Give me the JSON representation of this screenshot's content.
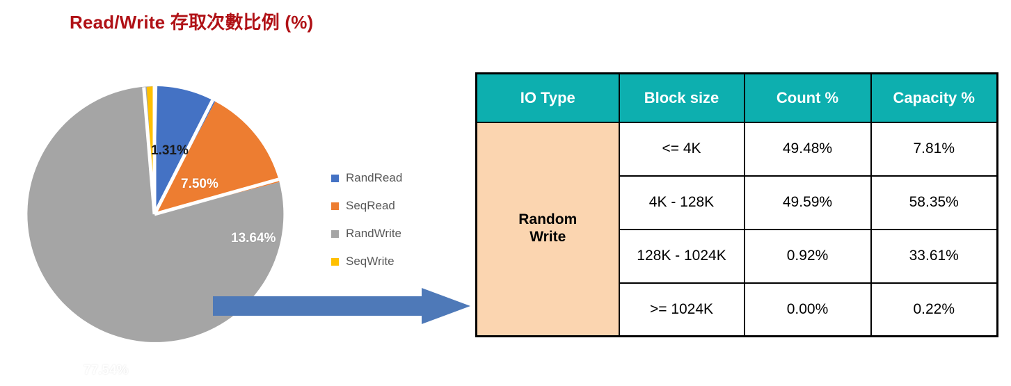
{
  "chart_data": {
    "type": "pie",
    "title": "Read/Write 存取次數比例 (%)",
    "unit": "%",
    "categories": [
      "RandRead",
      "SeqRead",
      "RandWrite",
      "SeqWrite"
    ],
    "values": [
      7.5,
      13.64,
      77.54,
      1.31
    ],
    "labels": [
      "7.50%",
      "13.64%",
      "77.54%",
      "1.31%"
    ],
    "colors": [
      "#4472C4",
      "#ED7D31",
      "#A5A5A5",
      "#FFC000"
    ],
    "legend_position": "right",
    "grid": false,
    "start_angle_deg": 0,
    "direction": "clockwise",
    "slice_gap": true
  },
  "title": {
    "text": "Read/Write 存取次數比例 (%)",
    "color": "#B01116"
  },
  "legend": {
    "items": [
      {
        "label": "RandRead",
        "color": "#4472C4"
      },
      {
        "label": "SeqRead",
        "color": "#ED7D31"
      },
      {
        "label": "RandWrite",
        "color": "#A5A5A5"
      },
      {
        "label": "SeqWrite",
        "color": "#FFC000"
      }
    ]
  },
  "pie_labels": {
    "seqwrite": "1.31%",
    "randread": "7.50%",
    "seqread": "13.64%",
    "randwrite": "77.54%"
  },
  "arrow": {
    "direction": "right",
    "color": "#4E79B8"
  },
  "table": {
    "accent_header_color": "#0DAFAF",
    "iotype_cell_color": "#FBD5B0",
    "headers": [
      "IO Type",
      "Block size",
      "Count %",
      "Capacity %"
    ],
    "io_type": "Random\nWrite",
    "io_type_line1": "Random",
    "io_type_line2": "Write",
    "rows": [
      {
        "block_size": "<= 4K",
        "count_pct": "49.48%",
        "capacity_pct": "7.81%"
      },
      {
        "block_size": "4K - 128K",
        "count_pct": "49.59%",
        "capacity_pct": "58.35%"
      },
      {
        "block_size": "128K - 1024K",
        "count_pct": "0.92%",
        "capacity_pct": "33.61%"
      },
      {
        "block_size": ">= 1024K",
        "count_pct": "0.00%",
        "capacity_pct": "0.22%"
      }
    ]
  }
}
